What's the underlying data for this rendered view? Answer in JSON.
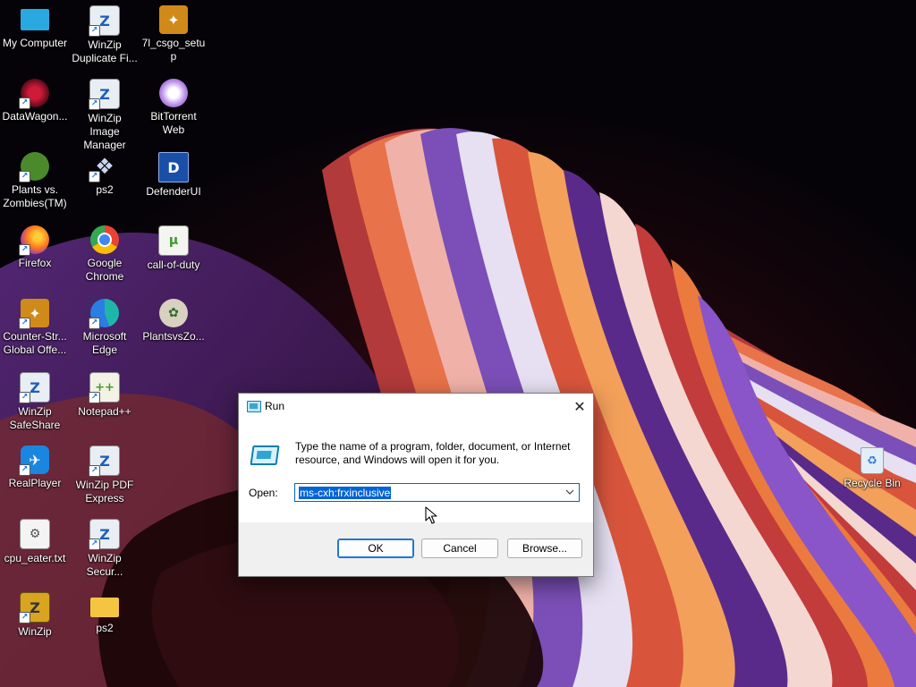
{
  "desktop": {
    "icons": [
      {
        "label": "My Computer",
        "icon": "monitor-icon"
      },
      {
        "label": "WinZip Duplicate Fi...",
        "icon": "winzip-file-icon"
      },
      {
        "label": "7l_csgo_setup",
        "icon": "csgo-icon"
      },
      {
        "label": "DataWagon...",
        "icon": "datawagon-icon"
      },
      {
        "label": "WinZip Image Manager",
        "icon": "winzip-image-icon"
      },
      {
        "label": "BitTorrent Web",
        "icon": "bittorrent-icon"
      },
      {
        "label": "Plants vs. Zombies(TM)",
        "icon": "plants-icon"
      },
      {
        "label": "ps2",
        "icon": "ps2-icon"
      },
      {
        "label": "DefenderUI",
        "icon": "defender-icon"
      },
      {
        "label": "Firefox",
        "icon": "firefox-icon"
      },
      {
        "label": "Google Chrome",
        "icon": "chrome-icon"
      },
      {
        "label": "call-of-duty",
        "icon": "torrent-file-icon"
      },
      {
        "label": "Counter-Str... Global Offe...",
        "icon": "csgo-icon"
      },
      {
        "label": "Microsoft Edge",
        "icon": "edge-icon"
      },
      {
        "label": "PlantsvsZo...",
        "icon": "plants-icon"
      },
      {
        "label": "WinZip SafeShare",
        "icon": "winzip-safeshare-icon"
      },
      {
        "label": "Notepad++",
        "icon": "notepadpp-icon"
      },
      {
        "label": "RealPlayer",
        "icon": "realplayer-icon"
      },
      {
        "label": "WinZip PDF Express",
        "icon": "winzip-pdf-icon"
      },
      {
        "label": "cpu_eater.txt",
        "icon": "text-file-icon"
      },
      {
        "label": "WinZip Secur...",
        "icon": "winzip-secure-icon"
      },
      {
        "label": "WinZip",
        "icon": "winzip-icon"
      },
      {
        "label": "ps2",
        "icon": "folder-icon"
      },
      {
        "label": "Recycle Bin",
        "icon": "recycle-bin-icon"
      }
    ]
  },
  "run_dialog": {
    "title": "Run",
    "close_glyph": "✕",
    "description": "Type the name of a program, folder, document, or Internet resource, and Windows will open it for you.",
    "open_label": "Open:",
    "input_value": "ms-cxh:frxinclusive",
    "ok_label": "OK",
    "cancel_label": "Cancel",
    "browse_label": "Browse..."
  },
  "colors": {
    "accent": "#0063d8",
    "dialog_footer": "#f0f0f0"
  }
}
